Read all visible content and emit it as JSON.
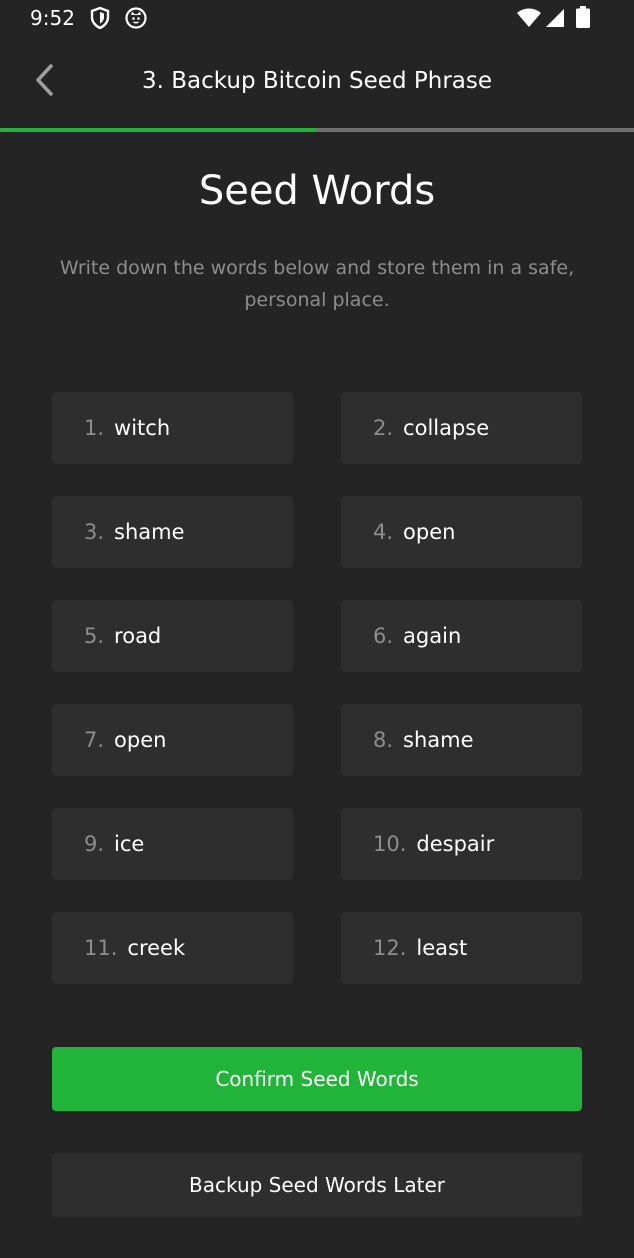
{
  "status_bar": {
    "time": "9:52",
    "left_icons": [
      "shield-icon",
      "cat-icon"
    ],
    "right_icons": [
      "wifi-icon",
      "cell-signal-icon",
      "battery-icon"
    ]
  },
  "header": {
    "back_icon": "chevron-left-icon",
    "title": "3. Backup Bitcoin Seed Phrase"
  },
  "progress": {
    "fraction": 0.5,
    "fill_color": "#22b33a",
    "track_color": "#6f6f6f"
  },
  "main": {
    "title": "Seed Words",
    "subtitle": "Write down the words below and store them in a safe, personal place.",
    "words": [
      {
        "num": "1.",
        "word": "witch"
      },
      {
        "num": "2.",
        "word": "collapse"
      },
      {
        "num": "3.",
        "word": "shame"
      },
      {
        "num": "4.",
        "word": "open"
      },
      {
        "num": "5.",
        "word": "road"
      },
      {
        "num": "6.",
        "word": "again"
      },
      {
        "num": "7.",
        "word": "open"
      },
      {
        "num": "8.",
        "word": "shame"
      },
      {
        "num": "9.",
        "word": "ice"
      },
      {
        "num": "10.",
        "word": "despair"
      },
      {
        "num": "11.",
        "word": "creek"
      },
      {
        "num": "12.",
        "word": "least"
      }
    ]
  },
  "actions": {
    "confirm_label": "Confirm Seed Words",
    "later_label": "Backup Seed Words Later"
  },
  "colors": {
    "background": "#242424",
    "card": "#2e2e2e",
    "accent": "#22b33a",
    "muted_text": "#8d8d8d"
  }
}
